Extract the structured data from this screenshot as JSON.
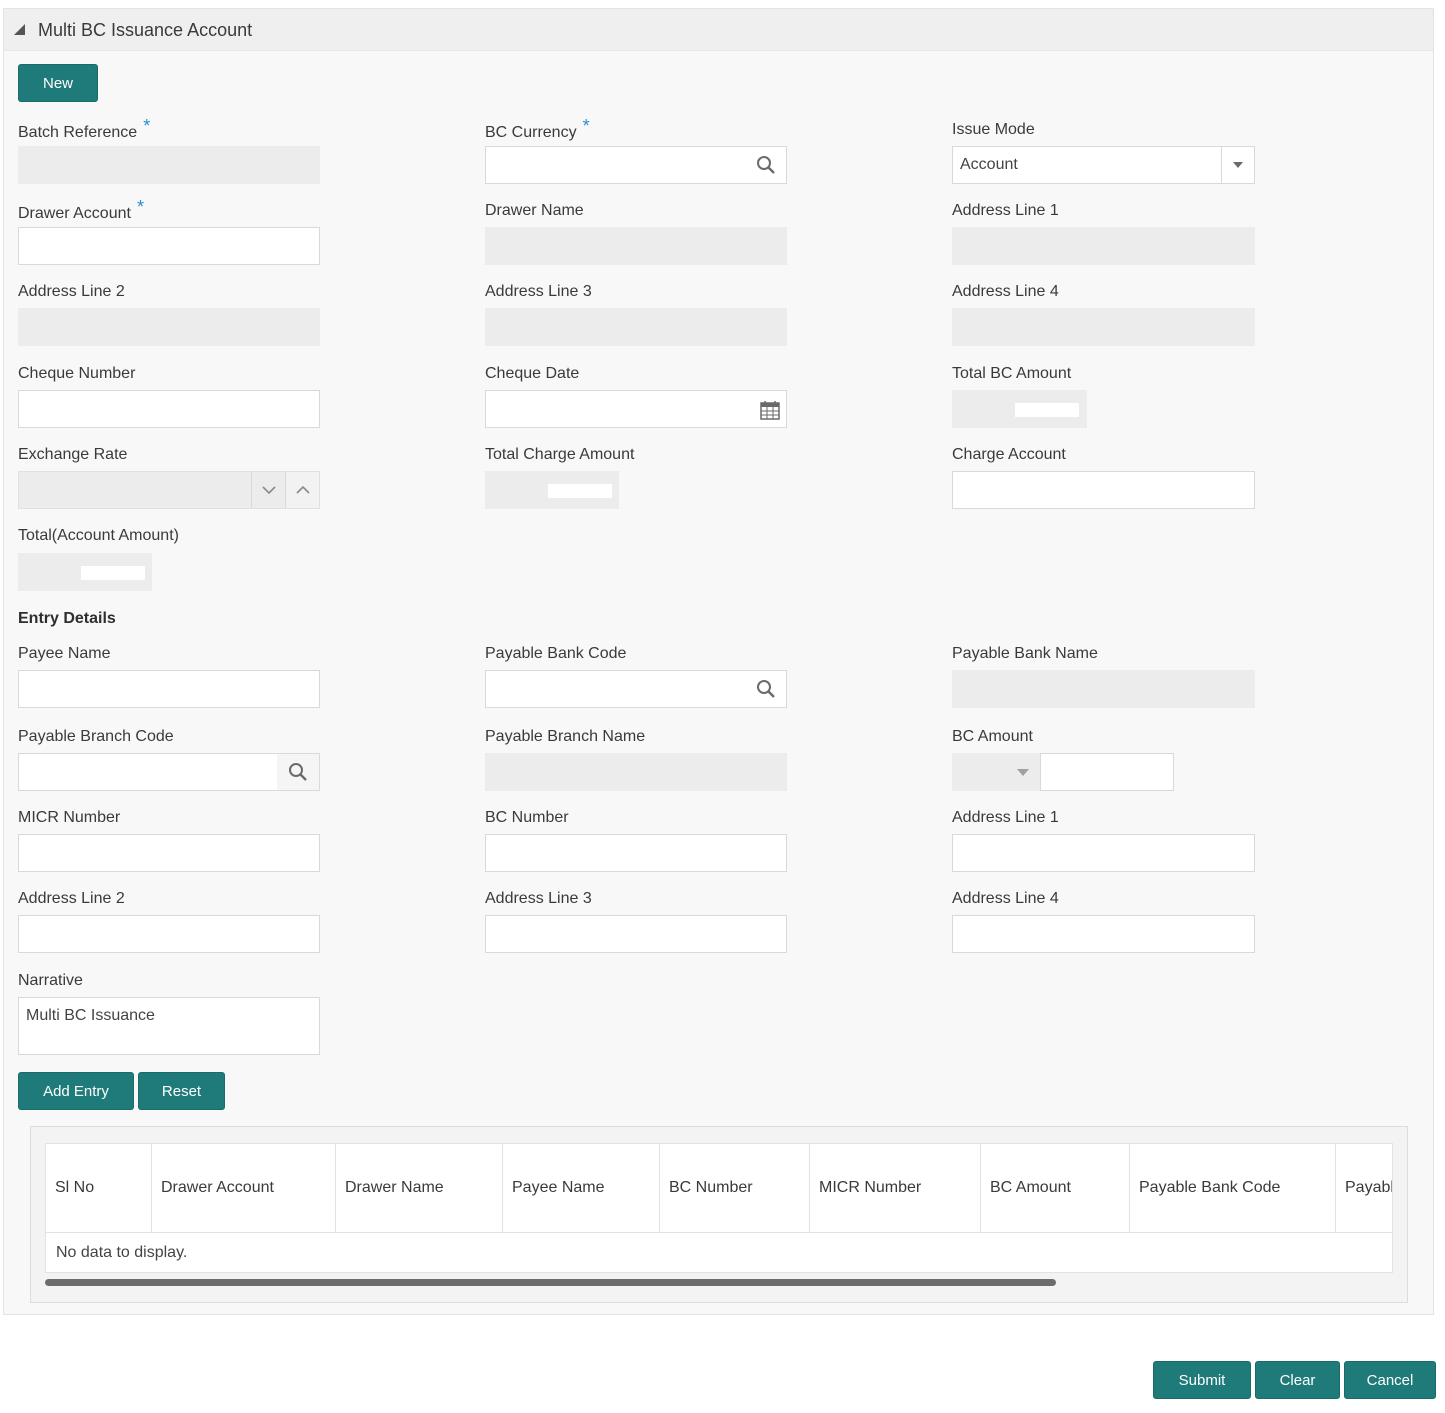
{
  "panel": {
    "title": "Multi BC Issuance Account"
  },
  "buttons": {
    "new": "New",
    "add_entry": "Add Entry",
    "reset": "Reset",
    "submit": "Submit",
    "clear": "Clear",
    "cancel": "Cancel"
  },
  "form": {
    "batch_reference": {
      "label": "Batch Reference",
      "value": ""
    },
    "bc_currency": {
      "label": "BC Currency",
      "value": ""
    },
    "issue_mode": {
      "label": "Issue Mode",
      "value": "Account"
    },
    "drawer_account": {
      "label": "Drawer Account",
      "value": ""
    },
    "drawer_name": {
      "label": "Drawer Name",
      "value": ""
    },
    "address_line_1": {
      "label": "Address Line 1",
      "value": ""
    },
    "address_line_2": {
      "label": "Address Line 2",
      "value": ""
    },
    "address_line_3": {
      "label": "Address Line 3",
      "value": ""
    },
    "address_line_4": {
      "label": "Address Line 4",
      "value": ""
    },
    "cheque_number": {
      "label": "Cheque Number",
      "value": ""
    },
    "cheque_date": {
      "label": "Cheque Date",
      "value": ""
    },
    "total_bc_amount": {
      "label": "Total BC Amount"
    },
    "exchange_rate": {
      "label": "Exchange Rate",
      "value": ""
    },
    "total_charge_amount": {
      "label": "Total Charge Amount"
    },
    "charge_account": {
      "label": "Charge Account",
      "value": ""
    },
    "total_account_amount": {
      "label": "Total(Account Amount)"
    },
    "required_marker": "*"
  },
  "entry": {
    "section_title": "Entry Details",
    "payee_name": {
      "label": "Payee Name",
      "value": ""
    },
    "payable_bank_code": {
      "label": "Payable Bank Code",
      "value": ""
    },
    "payable_bank_name": {
      "label": "Payable Bank Name",
      "value": ""
    },
    "payable_branch_code": {
      "label": "Payable Branch Code",
      "value": ""
    },
    "payable_branch_name": {
      "label": "Payable Branch Name",
      "value": ""
    },
    "bc_amount": {
      "label": "BC Amount",
      "value": ""
    },
    "micr_number": {
      "label": "MICR Number",
      "value": ""
    },
    "bc_number": {
      "label": "BC Number",
      "value": ""
    },
    "address_line_1": {
      "label": "Address Line 1",
      "value": ""
    },
    "address_line_2": {
      "label": "Address Line 2",
      "value": ""
    },
    "address_line_3": {
      "label": "Address Line 3",
      "value": ""
    },
    "address_line_4": {
      "label": "Address Line 4",
      "value": ""
    },
    "narrative": {
      "label": "Narrative",
      "value": "Multi BC Issuance"
    }
  },
  "grid": {
    "columns": [
      "Sl No",
      "Drawer Account",
      "Drawer Name",
      "Payee Name",
      "BC Number",
      "MICR Number",
      "BC Amount",
      "Payable Bank Code",
      "Payabl"
    ],
    "empty_message": "No data to display.",
    "scroll_fraction": 0.75
  },
  "colors": {
    "accent": "#1f7b79",
    "required": "#2b8ed1",
    "readonly_bg": "#ececec"
  },
  "icons": [
    "collapse-triangle-icon",
    "search-icon",
    "calendar-icon",
    "chevron-down-icon",
    "chevron-up-icon"
  ]
}
